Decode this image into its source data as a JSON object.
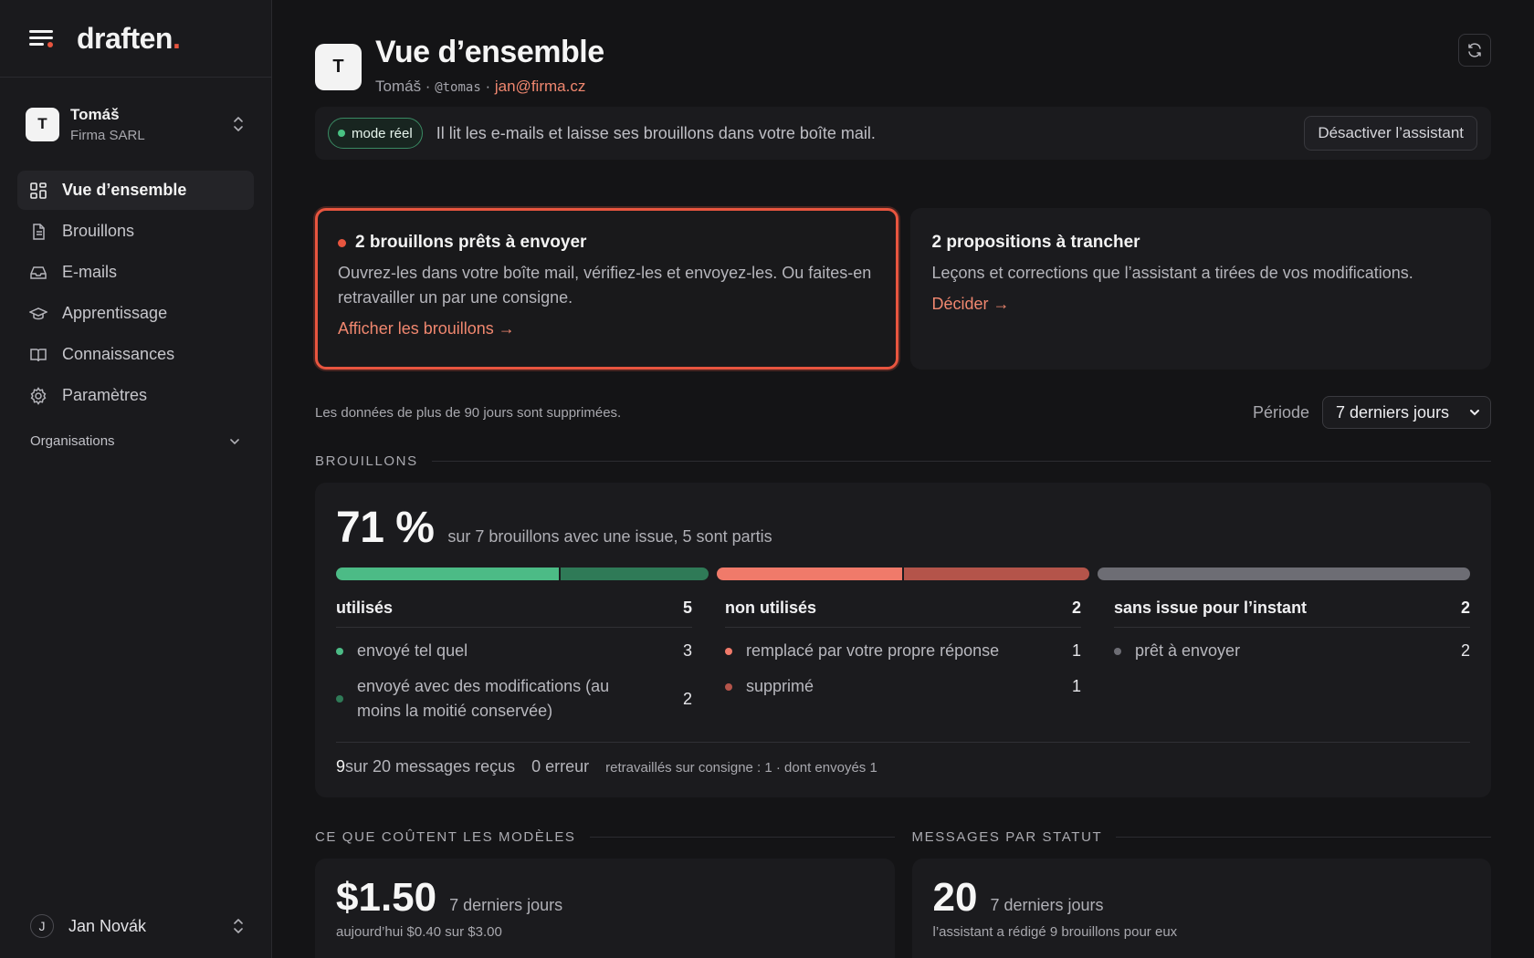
{
  "app": {
    "brand": "draften",
    "brand_dot": "."
  },
  "account": {
    "initial": "T",
    "name": "Tomáš",
    "org": "Firma SARL"
  },
  "nav": [
    {
      "label": "Vue d’ensemble",
      "icon": "dashboard-icon",
      "active": true
    },
    {
      "label": "Brouillons",
      "icon": "document-icon"
    },
    {
      "label": "E-mails",
      "icon": "inbox-icon"
    },
    {
      "label": "Apprentissage",
      "icon": "graduation-cap-icon"
    },
    {
      "label": "Connaissances",
      "icon": "book-icon"
    },
    {
      "label": "Paramètres",
      "icon": "gear-icon"
    }
  ],
  "organisations_label": "Organisations",
  "user": {
    "initial": "J",
    "name": "Jan Novák"
  },
  "header": {
    "initial": "T",
    "title": "Vue d’ensemble",
    "name": "Tomáš",
    "sep": " · ",
    "handle": "@tomas",
    "email": "jan@firma.cz"
  },
  "banner": {
    "pill": "mode réel",
    "text": "Il lit les e-mails et laisse ses brouillons dans votre boîte mail.",
    "button": "Désactiver l’assistant"
  },
  "cards": {
    "drafts": {
      "title": "2 brouillons prêts à envoyer",
      "body": "Ouvrez-les dans votre boîte mail, vérifiez-les et envoyez-les. Ou faites-en retravailler un par une consigne.",
      "link": "Afficher les brouillons →"
    },
    "proposals": {
      "title": "2 propositions à trancher",
      "body": "Leçons et corrections que l’assistant a tirées de vos modifications.",
      "link": "Décider →"
    }
  },
  "retention": "Les données de plus de 90 jours sont supprimées.",
  "period": {
    "label": "Période",
    "value": "7 derniers jours"
  },
  "drafts_section": {
    "label": "BROUILLONS",
    "rate": "71 %",
    "rate_desc": "sur 7 brouillons avec une issue, 5 sont partis",
    "groups": [
      {
        "title": "utilisés",
        "count": "5",
        "items": [
          {
            "label": "envoyé tel quel",
            "value": "3",
            "color": "#4cbb86"
          },
          {
            "label": "envoyé avec des modifications (au moins la moitié conservée)",
            "value": "2",
            "color": "#2f7a57"
          }
        ]
      },
      {
        "title": "non utilisés",
        "count": "2",
        "items": [
          {
            "label": "remplacé par votre propre réponse",
            "value": "1",
            "color": "#f07a6a"
          },
          {
            "label": "supprimé",
            "value": "1",
            "color": "#b4544a"
          }
        ]
      },
      {
        "title": "sans issue pour l’instant",
        "count": "2",
        "items": [
          {
            "label": "prêt à envoyer",
            "value": "2",
            "color": "#6d6d74"
          }
        ]
      }
    ],
    "footer": {
      "received_num": "9",
      "received_text": " sur 20 messages reçus",
      "errors": "0 erreur",
      "reworked": "retravaillés sur consigne : 1 · dont envoyés 1"
    }
  },
  "costs": {
    "label": "CE QUE COÛTENT LES MODÈLES",
    "value": "$1.50",
    "period": "7 derniers jours",
    "sub": "aujourd’hui $0.40 sur $3.00"
  },
  "statuses": {
    "label": "MESSAGES PAR STATUT",
    "value": "20",
    "period": "7 derniers jours",
    "sub": "l’assistant a rédigé 9 brouillons pour eux"
  }
}
